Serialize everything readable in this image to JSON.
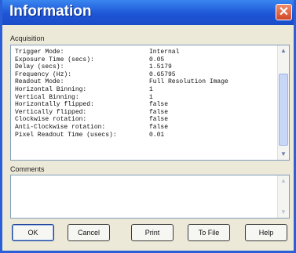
{
  "window": {
    "title": "Information",
    "close_glyph": "✕"
  },
  "acquisition": {
    "label": "Acquisition",
    "rows": [
      {
        "key": "Trigger Mode:",
        "value": "Internal"
      },
      {
        "key": "Exposure Time (secs):",
        "value": "0.05"
      },
      {
        "key": "Delay (secs):",
        "value": "1.5179"
      },
      {
        "key": "Frequency (Hz):",
        "value": "0.65795"
      },
      {
        "key": "Readout Mode:",
        "value": "Full Resolution Image"
      },
      {
        "key": "Horizontal Binning:",
        "value": "1"
      },
      {
        "key": "Vertical Binning:",
        "value": "1"
      },
      {
        "key": "Horizontally flipped:",
        "value": "false"
      },
      {
        "key": "Vertically flipped:",
        "value": "false"
      },
      {
        "key": "Clockwise rotation:",
        "value": "false"
      },
      {
        "key": "Anti-Clockwise rotation:",
        "value": "false"
      },
      {
        "key": "Pixel Readout Time (usecs):",
        "value": "0.01"
      }
    ]
  },
  "comments": {
    "label": "Comments",
    "value": ""
  },
  "buttons": {
    "ok": "OK",
    "cancel": "Cancel",
    "print": "Print",
    "to_file": "To File",
    "help": "Help"
  },
  "scroll": {
    "acquisition_position": 0.85
  }
}
